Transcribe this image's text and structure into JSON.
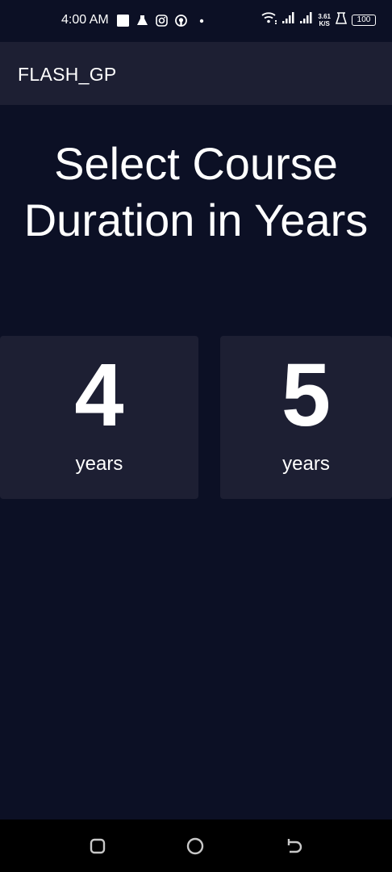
{
  "status_bar": {
    "time": "4:00 AM",
    "net_speed_value": "3.61",
    "net_speed_unit": "K/S",
    "battery": "100",
    "icons": [
      "square-icon",
      "flask-icon",
      "instagram-icon",
      "github-icon",
      "dot-icon",
      "wifi-icon",
      "signal-icon",
      "signal-icon-2",
      "alarm-icon",
      "battery-icon"
    ]
  },
  "app_bar": {
    "title": "FLASH_GP"
  },
  "main": {
    "heading_line1": "Select Course",
    "heading_line2": "Duration in Years",
    "options": [
      {
        "number": "4",
        "label": "years"
      },
      {
        "number": "5",
        "label": "years"
      }
    ]
  },
  "nav_bar": {
    "buttons": [
      "recents-icon",
      "home-icon",
      "back-icon"
    ]
  },
  "colors": {
    "background": "#0c1025",
    "surface": "#1d1f33",
    "text": "#ffffff",
    "nav_background": "#000000"
  }
}
